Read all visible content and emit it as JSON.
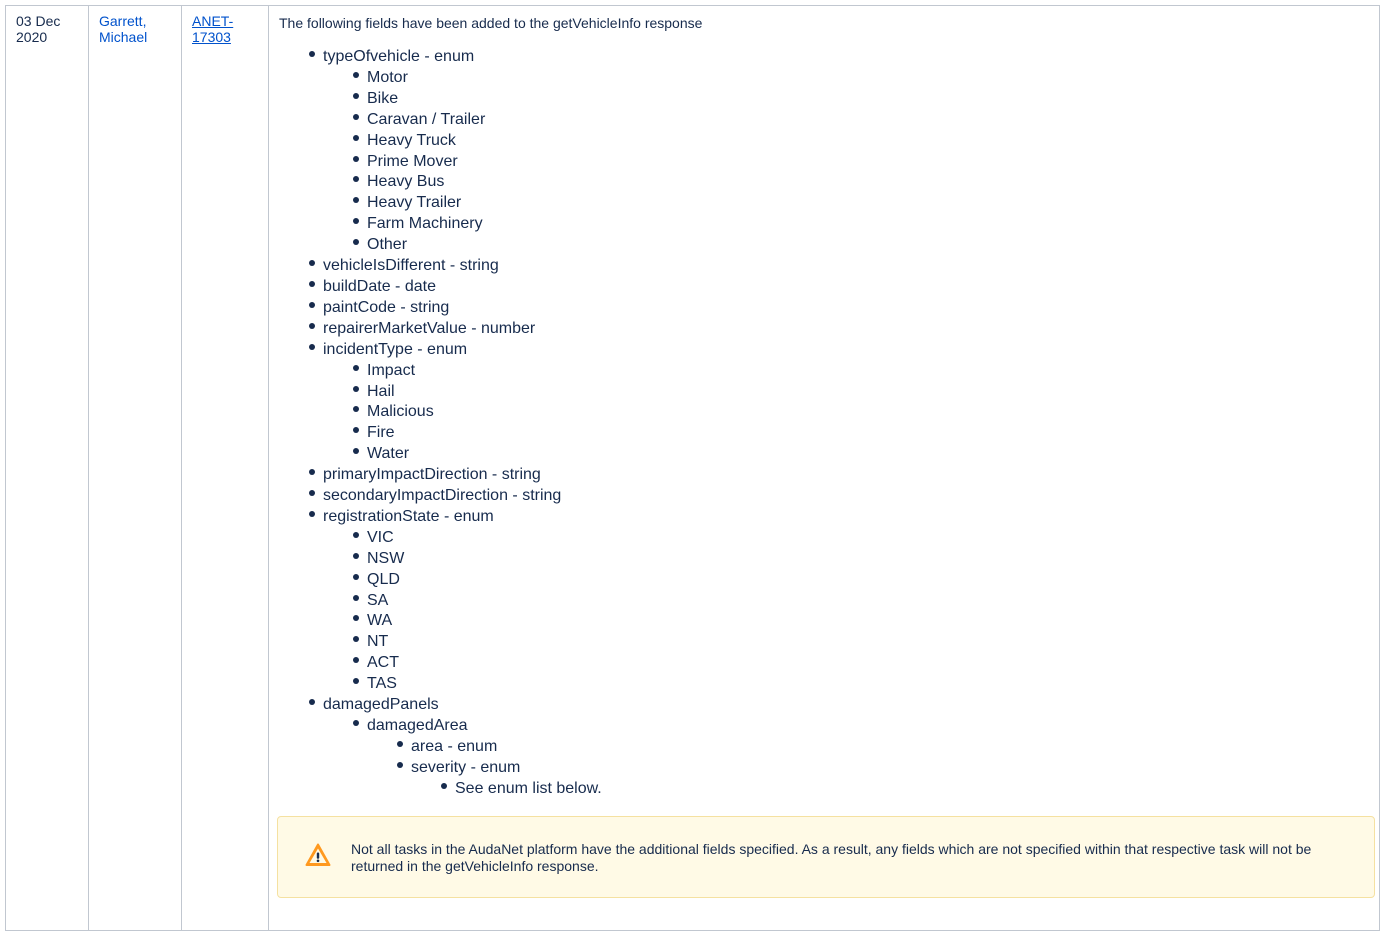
{
  "row": {
    "date": [
      "03 Dec",
      "2020"
    ],
    "author": [
      "Garrett,",
      "Michael"
    ],
    "ticket": [
      "ANET-",
      "17303"
    ],
    "intro": "The following fields have been added to the getVehicleInfo response",
    "fields": [
      {
        "label": "typeOfvehicle - enum",
        "children": [
          {
            "label": "Motor"
          },
          {
            "label": "Bike"
          },
          {
            "label": "Caravan / Trailer"
          },
          {
            "label": "Heavy Truck"
          },
          {
            "label": "Prime Mover"
          },
          {
            "label": "Heavy Bus"
          },
          {
            "label": "Heavy Trailer"
          },
          {
            "label": "Farm Machinery"
          },
          {
            "label": "Other"
          }
        ]
      },
      {
        "label": "vehicleIsDifferent - string"
      },
      {
        "label": "buildDate - date"
      },
      {
        "label": "paintCode - string"
      },
      {
        "label": "repairerMarketValue - number"
      },
      {
        "label": "incidentType - enum",
        "children": [
          {
            "label": "Impact"
          },
          {
            "label": "Hail"
          },
          {
            "label": "Malicious"
          },
          {
            "label": "Fire"
          },
          {
            "label": "Water"
          }
        ]
      },
      {
        "label": "primaryImpactDirection - string"
      },
      {
        "label": "secondaryImpactDirection - string"
      },
      {
        "label": "registrationState - enum",
        "children": [
          {
            "label": "VIC"
          },
          {
            "label": "NSW"
          },
          {
            "label": "QLD"
          },
          {
            "label": "SA"
          },
          {
            "label": "WA"
          },
          {
            "label": "NT"
          },
          {
            "label": "ACT"
          },
          {
            "label": "TAS"
          }
        ]
      },
      {
        "label": "damagedPanels",
        "children": [
          {
            "label": "damagedArea",
            "children": [
              {
                "label": "area - enum"
              },
              {
                "label": "severity - enum",
                "children": [
                  {
                    "label": "See enum list below."
                  }
                ]
              }
            ]
          }
        ]
      }
    ],
    "warning": {
      "icon": "warning-triangle-icon",
      "text": "Not all tasks in the AudaNet platform have the additional fields specified. As a result, any fields which are not specified within that respective task will not be returned in the getVehicleInfo response.",
      "colors": {
        "background": "#fffae6",
        "border": "#f5e1a1",
        "icon": "#ff991f"
      }
    }
  },
  "colors": {
    "link": "#0052cc",
    "text": "#172b4d",
    "border": "#c1c7d0"
  }
}
